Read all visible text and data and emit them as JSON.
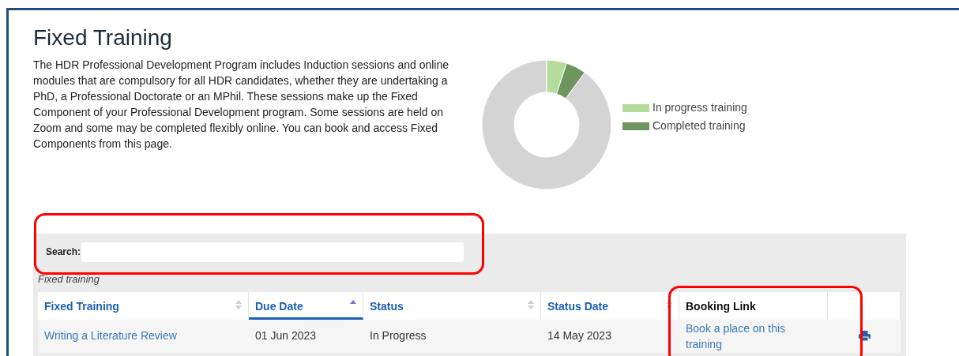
{
  "page": {
    "title": "Fixed Training",
    "intro": "The HDR Professional Development Program includes Induction sessions and online modules that are compulsory for all HDR candidates, whether they are undertaking a PhD, a Professional Doctorate or an MPhil. These sessions make up the Fixed Component of your Professional Development program. Some sessions are held on Zoom and some may be completed flexibly online. You can book and access Fixed Components from this page."
  },
  "chart_legend": [
    {
      "label": "In progress training",
      "color": "#b5dc9b"
    },
    {
      "label": "Completed training",
      "color": "#6e9460"
    }
  ],
  "search": {
    "label": "Search:"
  },
  "table": {
    "caption": "Fixed training",
    "columns": [
      {
        "label": "Fixed Training",
        "sortable": true,
        "selected": false
      },
      {
        "label": "Due Date",
        "sortable": true,
        "selected": true
      },
      {
        "label": "Status",
        "sortable": true,
        "selected": false
      },
      {
        "label": "Status Date",
        "sortable": true,
        "selected": false
      },
      {
        "label": "Booking Link",
        "sortable": false,
        "selected": false
      },
      {
        "sortable": false,
        "selected": false
      }
    ],
    "rows": [
      {
        "training": "Writing a Literature Review",
        "due_date": "01 Jun 2023",
        "status": "In Progress",
        "status_date": "14 May 2023",
        "booking_link": "Book a place on this training"
      }
    ]
  }
}
